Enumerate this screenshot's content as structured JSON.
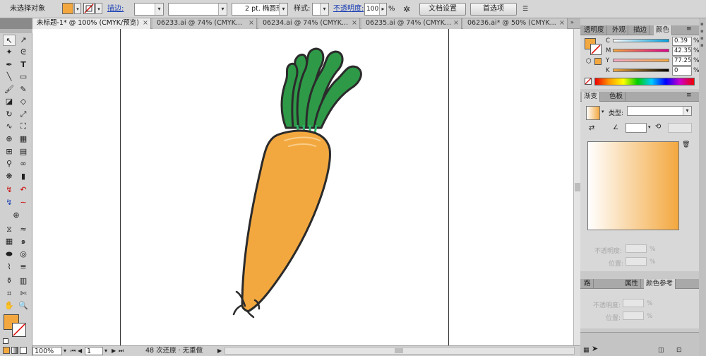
{
  "control_bar": {
    "selection_label": "未选择对象",
    "stroke_label": "描边:",
    "brush_value": "2 pt. 椭圆形",
    "style_label": "样式:",
    "opacity_label": "不透明度:",
    "opacity_value": "100",
    "percent": "%",
    "doc_setup_button": "文档设置",
    "preferences_button": "首选项"
  },
  "tabs": [
    {
      "label": "未标题-1* @ 100% (CMYK/预览)",
      "active": true
    },
    {
      "label": "06233.ai @ 74% (CMYK..."
    },
    {
      "label": "06234.ai @ 74% (CMYK..."
    },
    {
      "label": "06235.ai @ 74% (CMYK..."
    },
    {
      "label": "06236.ai* @ 50% (CMYK..."
    }
  ],
  "tab_close": "×",
  "status_bar": {
    "zoom": "100%",
    "page": "1",
    "undo_text": "48 次还原 · 无重做"
  },
  "color_panel": {
    "tabs": [
      "透明度",
      "外观",
      "描边",
      "颜色"
    ],
    "channels": [
      {
        "label": "C",
        "value": "0.39",
        "color": "#00a0e0"
      },
      {
        "label": "M",
        "value": "42.35",
        "color": "#e0008c"
      },
      {
        "label": "Y",
        "value": "77.25",
        "color": "#f2e600"
      },
      {
        "label": "K",
        "value": "0",
        "color": "#000000"
      }
    ],
    "fill_color": "#f3a83f",
    "percent": "%"
  },
  "gradient_panel": {
    "tabs": [
      "渐变",
      "色板"
    ],
    "type_label": "类型:",
    "opacity_label": "不透明度:",
    "position_label": "位置:",
    "percent": "%"
  },
  "bottom_panel": {
    "tabs": [
      "路",
      "属性",
      "颜色参考"
    ],
    "opacity_label": "不透明度:",
    "position_label": "位置:",
    "percent": "%"
  },
  "colors": {
    "carrot": "#f3a83f",
    "leaf": "#2e9a48",
    "outline": "#2b2b2b"
  }
}
